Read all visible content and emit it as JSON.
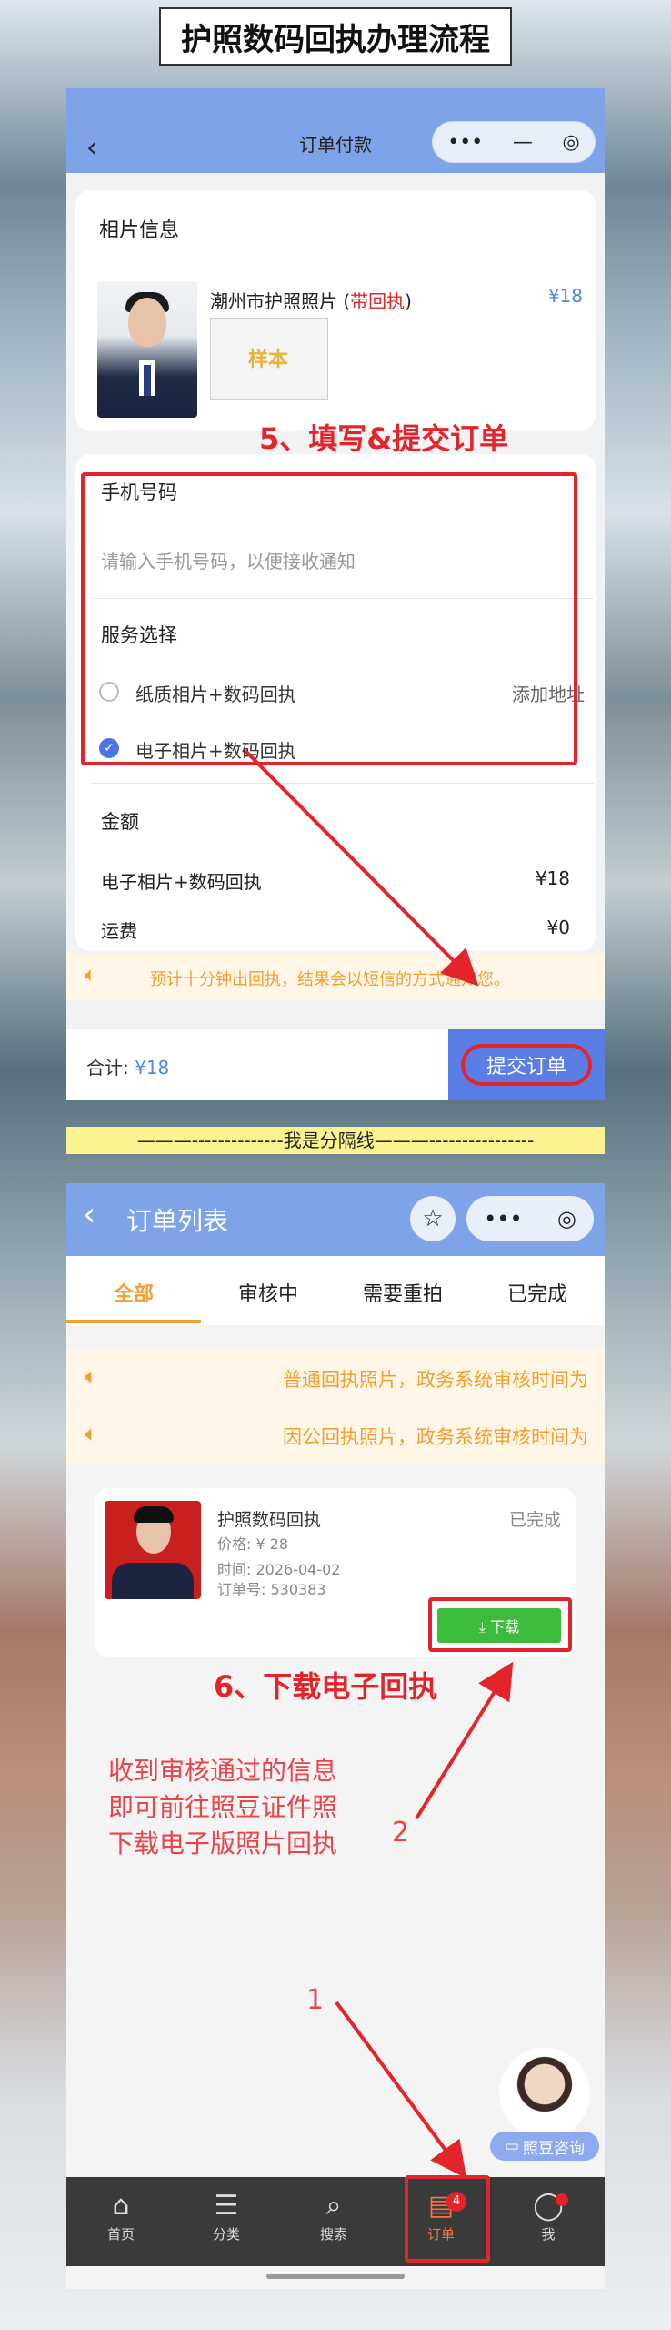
{
  "title": "护照数码回执办理流程",
  "top": {
    "nav_title": "订单付款",
    "back": "‹",
    "capsule_more": "•••",
    "capsule_min": "—",
    "capsule_close": "◎",
    "photo_section_title": "相片信息",
    "product_name": "潮州市护照照片 (",
    "product_highlight": "带回执",
    "product_name_end": ")",
    "product_price": "¥18",
    "sample_stamp": "样本",
    "step5": "5、填写&提交订单",
    "phone_label": "手机号码",
    "phone_placeholder": "请输入手机号码，以便接收通知",
    "service_label": "服务选择",
    "option1": "纸质相片+数码回执",
    "add_address": "添加地址",
    "option2": "电子相片+数码回执",
    "amount_title": "金额",
    "amount_item": "电子相片+数码回执",
    "amount_item_price": "¥18",
    "shipping_label": "运费",
    "shipping_price": "¥0",
    "notice": "预计十分钟出回执，结果会以短信的方式通知您。",
    "total_label": "合计: ",
    "total_value": "¥18",
    "submit": "提交订单"
  },
  "divider": "———--------------我是分隔线———----------------",
  "bottom": {
    "nav_title": "订单列表",
    "tabs": [
      "全部",
      "审核中",
      "需要重拍",
      "已完成"
    ],
    "notice1": "普通回执照片，政务系统审核时间为",
    "notice2": "因公回执照片，政务系统审核时间为",
    "order_title": "护照数码回执",
    "order_status": "已完成",
    "order_price": "价格:  ¥ 28",
    "order_time": "时间:  2026-04-02",
    "order_no": "订单号:  530383",
    "download": "⤓ 下载",
    "step6": "6、下载电子回执",
    "instruction_1": "收到审核通过的信息",
    "instruction_2": "即可前往照豆证件照",
    "instruction_3": "下载电子版照片回执",
    "marker_1": "1",
    "marker_2": "2",
    "consult": "照豆咨询",
    "tabbar": [
      {
        "icon": "⌂",
        "label": "首页"
      },
      {
        "icon": "☰",
        "label": "分类"
      },
      {
        "icon": "⌕",
        "label": "搜索"
      },
      {
        "icon": "▤",
        "label": "订单"
      },
      {
        "icon": "◯",
        "label": "我"
      }
    ],
    "order_badge": "4"
  },
  "colors": {
    "nav": "#7fa3e8",
    "accent": "#f0a030",
    "red": "#e3242b",
    "blue": "#4c86e8",
    "green": "#3dbb3d"
  }
}
